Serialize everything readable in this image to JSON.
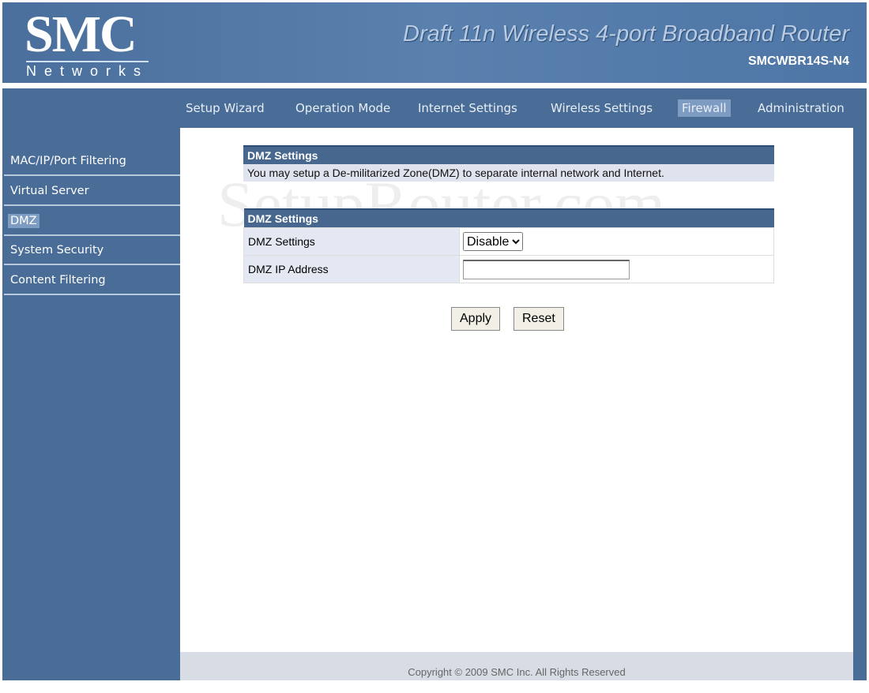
{
  "header": {
    "logo": "SMC",
    "logo_sub": "Networks",
    "product": "Draft 11n Wireless 4-port Broadband Router",
    "model": "SMCWBR14S-N4"
  },
  "nav": [
    {
      "label": "Setup Wizard"
    },
    {
      "label": "Operation Mode"
    },
    {
      "label": "Internet Settings"
    },
    {
      "label": "Wireless Settings"
    },
    {
      "label": "Firewall",
      "active": true
    },
    {
      "label": "Administration"
    }
  ],
  "sidebar": [
    {
      "label": "MAC/IP/Port Filtering"
    },
    {
      "label": "Virtual Server"
    },
    {
      "label": "DMZ",
      "active": true
    },
    {
      "label": "System Security"
    },
    {
      "label": "Content Filtering"
    }
  ],
  "intro": {
    "title": "DMZ Settings",
    "text": "You may setup a De-militarized Zone(DMZ) to separate internal network and Internet."
  },
  "form": {
    "title": "DMZ Settings",
    "settings_label": "DMZ Settings",
    "settings_value": "Disable",
    "ip_label": "DMZ IP Address",
    "ip_value": ""
  },
  "buttons": {
    "apply": "Apply",
    "reset": "Reset"
  },
  "footer": "Copyright © 2009 SMC Inc. All Rights Reserved",
  "watermark": "SetupRouter.com",
  "colors": {
    "brand_blue": "#4a6d98",
    "active": "#7e9cc2"
  }
}
